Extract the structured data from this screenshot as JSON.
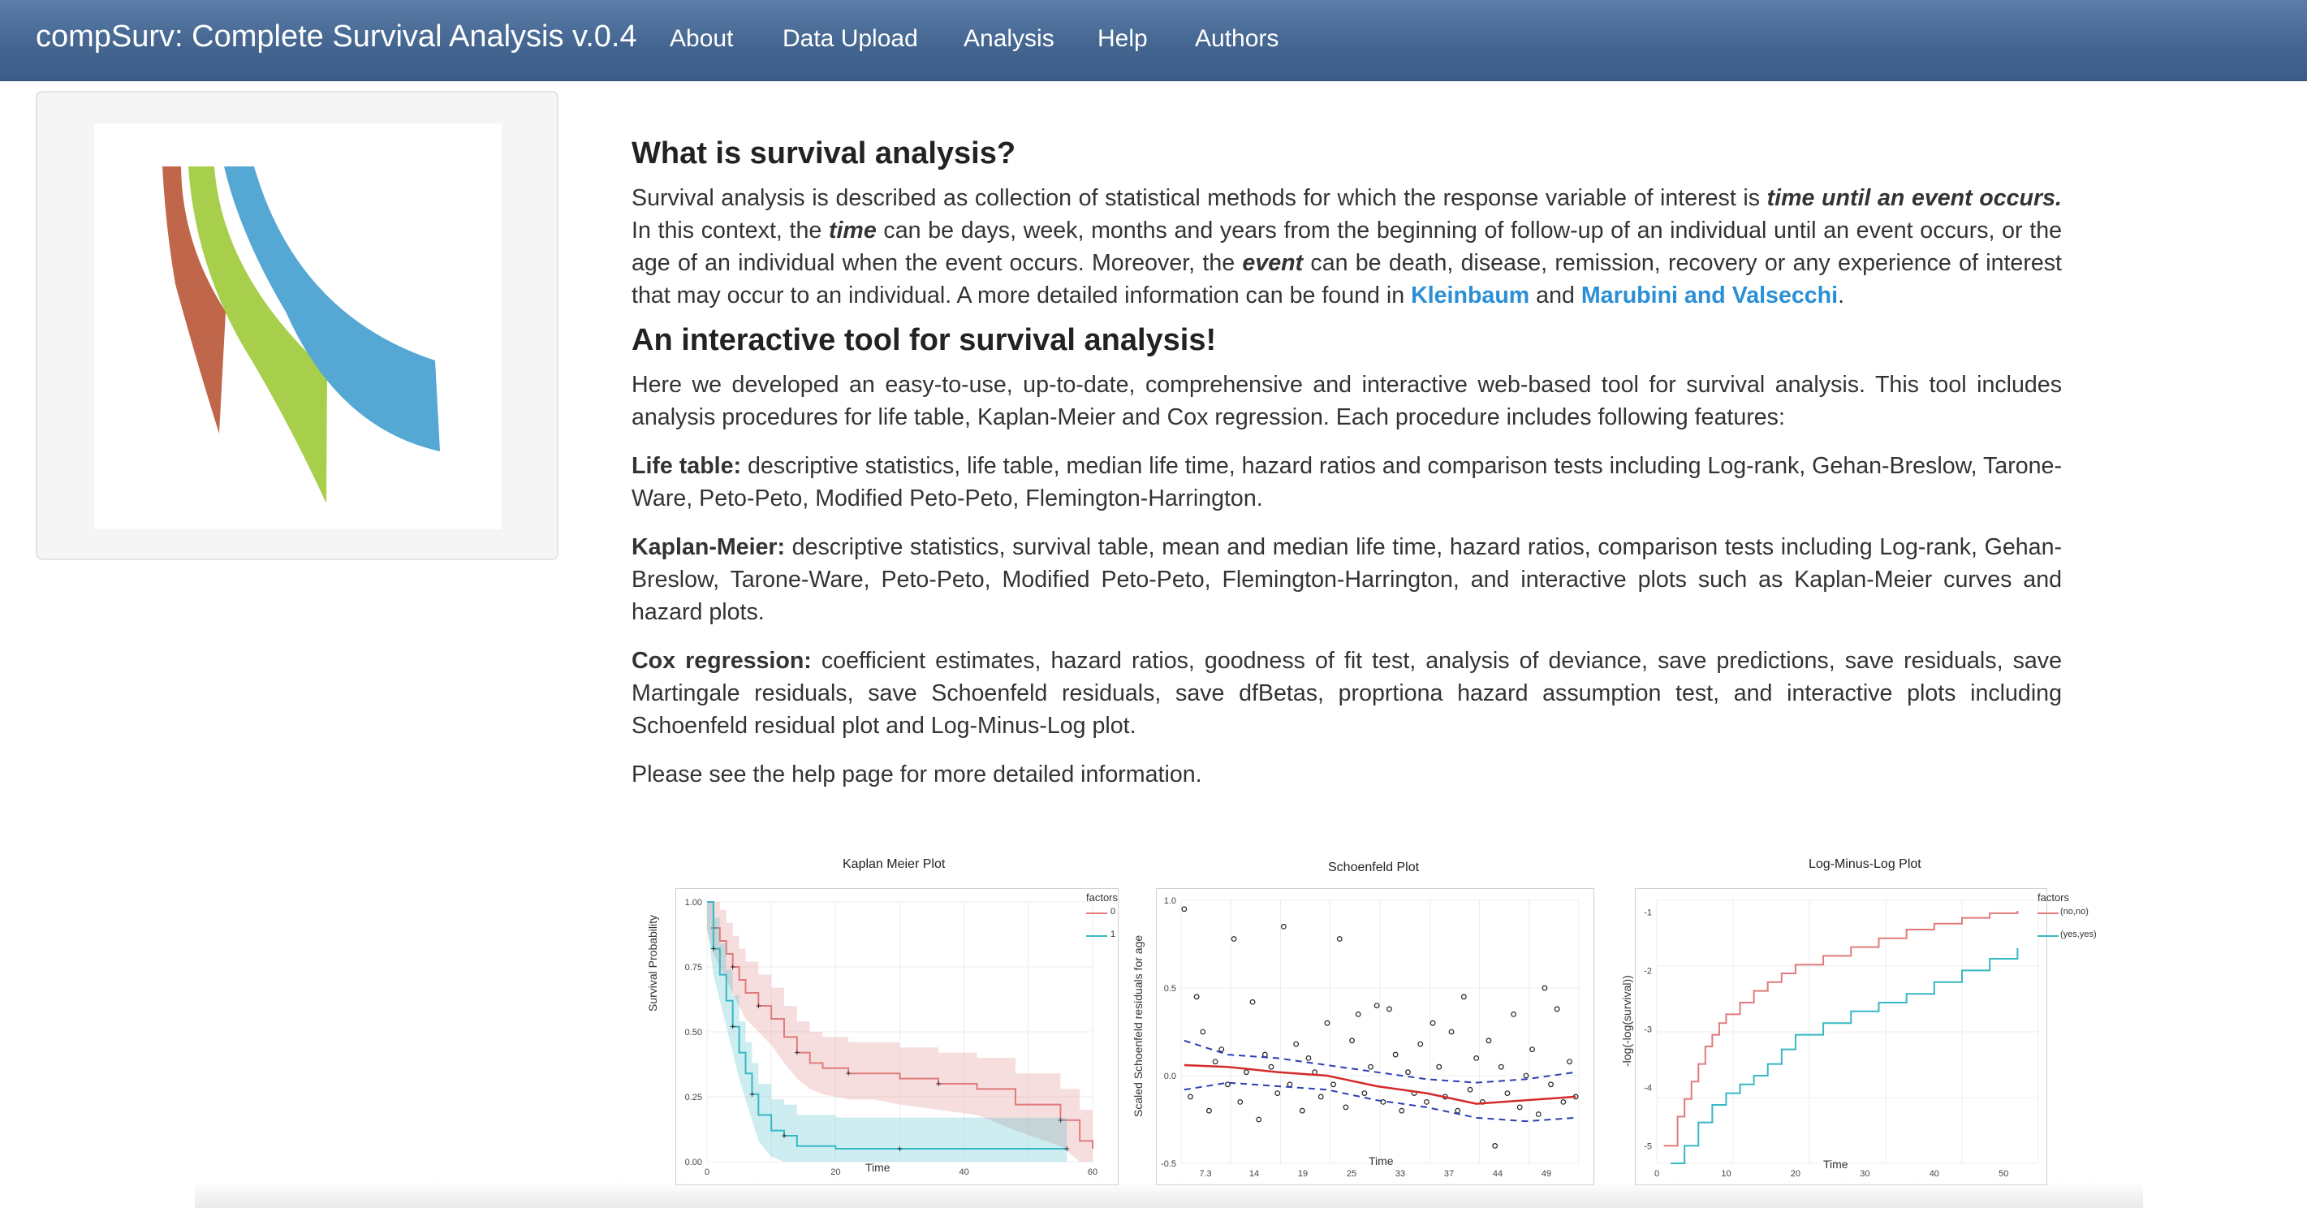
{
  "navbar": {
    "brand": "compSurv: Complete Survival Analysis v.0.4",
    "items": [
      {
        "label": "About",
        "active": true
      },
      {
        "label": "Data Upload"
      },
      {
        "label": "Analysis"
      },
      {
        "label": "Help"
      },
      {
        "label": "Authors"
      }
    ]
  },
  "logo": {
    "icon": "compsurv-logo-icon",
    "colors": [
      "#c0664a",
      "#a8cf4b",
      "#55a8d3"
    ]
  },
  "about": {
    "heading1": "What is survival analysis?",
    "p1": {
      "t1": "Survival analysis is described as collection of statistical methods for which the response variable of interest is ",
      "em1": "time until an event occurs.",
      "t2": " In this context, the ",
      "em2": "time",
      "t3": " can be days, week, months and years from the beginning of follow-up of an individual until an event occurs, or the age of an individual when the event occurs. Moreover, the ",
      "em3": "event",
      "t4": " can be death, disease, remission, recovery or any experience of interest that may occur to an individual. A more detailed information can be found in ",
      "link1": "Kleinbaum",
      "t5": " and ",
      "link2": "Marubini and Valsecchi",
      "t6": "."
    },
    "heading2": "An interactive tool for survival analysis!",
    "p2": "Here we developed an easy-to-use, up-to-date, comprehensive and interactive web-based tool for survival analysis. This tool includes analysis procedures for life table, Kaplan-Meier and Cox regression. Each procedure includes following features:",
    "lifetable": {
      "label": "Life table:",
      "text": " descriptive statistics, life table, median life time, hazard ratios and comparison tests including Log-rank, Gehan-Breslow, Tarone-Ware, Peto-Peto, Modified Peto-Peto, Flemington-Harrington."
    },
    "km": {
      "label": "Kaplan-Meier:",
      "text": " descriptive statistics, survival table, mean and median life time, hazard ratios, comparison tests including Log-rank, Gehan-Breslow, Tarone-Ware, Peto-Peto, Modified Peto-Peto, Flemington-Harrington, and interactive plots such as Kaplan-Meier curves and hazard plots."
    },
    "cox": {
      "label": "Cox regression:",
      "text": " coefficient estimates, hazard ratios, goodness of fit test, analysis of deviance, save predictions, save residuals, save Martingale residuals, save Schoenfeld residuals, save dfBetas, proprtiona hazard assumption test, and interactive plots including Schoenfeld residual plot and Log-Minus-Log plot."
    },
    "p_last": "Please see the help page for more detailed information."
  },
  "chart_data": [
    {
      "type": "line",
      "title": "Kaplan Meier Plot",
      "xlabel": "Time",
      "ylabel": "Survival Probability",
      "xlim": [
        0,
        60
      ],
      "ylim": [
        0,
        1
      ],
      "x_ticks": [
        "0",
        "20",
        "40",
        "60"
      ],
      "y_ticks": [
        "0.00",
        "0.25",
        "0.50",
        "0.75",
        "1.00"
      ],
      "legend": {
        "title": "factors",
        "position": "right"
      },
      "series": [
        {
          "name": "0",
          "color": "#e07b7b",
          "x": [
            0,
            1,
            2,
            3,
            4,
            5,
            6,
            8,
            10,
            12,
            14,
            16,
            18,
            22,
            26,
            30,
            36,
            42,
            48,
            55,
            58,
            60
          ],
          "y": [
            1.0,
            0.9,
            0.85,
            0.8,
            0.75,
            0.7,
            0.65,
            0.6,
            0.55,
            0.48,
            0.42,
            0.38,
            0.36,
            0.34,
            0.34,
            0.32,
            0.3,
            0.28,
            0.22,
            0.16,
            0.08,
            0.05
          ]
        },
        {
          "name": "1",
          "color": "#36b8c4",
          "x": [
            0,
            1,
            2,
            3,
            4,
            5,
            6,
            7,
            8,
            10,
            12,
            14,
            20,
            30,
            40,
            50,
            56
          ],
          "y": [
            1.0,
            0.82,
            0.72,
            0.62,
            0.52,
            0.42,
            0.34,
            0.26,
            0.18,
            0.12,
            0.1,
            0.06,
            0.05,
            0.05,
            0.05,
            0.05,
            0.05
          ]
        }
      ]
    },
    {
      "type": "scatter",
      "title": "Schoenfeld Plot",
      "xlabel": "Time",
      "ylabel": "Scaled Schoenfeld residuals for age",
      "x_ticks": [
        "7.3",
        "14",
        "19",
        "25",
        "33",
        "37",
        "44",
        "49"
      ],
      "y_ticks": [
        "-0.5",
        "0.0",
        "0.5",
        "1.0"
      ],
      "ylim": [
        -0.5,
        1.0
      ],
      "points": [
        [
          1,
          0.95
        ],
        [
          2,
          -0.12
        ],
        [
          3,
          0.45
        ],
        [
          4,
          0.25
        ],
        [
          5,
          -0.2
        ],
        [
          6,
          0.08
        ],
        [
          7,
          0.15
        ],
        [
          8,
          -0.05
        ],
        [
          9,
          0.78
        ],
        [
          10,
          -0.15
        ],
        [
          11,
          0.02
        ],
        [
          12,
          0.42
        ],
        [
          13,
          -0.25
        ],
        [
          14,
          0.12
        ],
        [
          15,
          0.05
        ],
        [
          16,
          -0.1
        ],
        [
          17,
          0.85
        ],
        [
          18,
          -0.05
        ],
        [
          19,
          0.18
        ],
        [
          20,
          -0.2
        ],
        [
          21,
          0.1
        ],
        [
          22,
          0.02
        ],
        [
          23,
          -0.12
        ],
        [
          24,
          0.3
        ],
        [
          25,
          -0.05
        ],
        [
          26,
          0.78
        ],
        [
          27,
          -0.18
        ],
        [
          28,
          0.2
        ],
        [
          29,
          0.35
        ],
        [
          30,
          -0.1
        ],
        [
          31,
          0.05
        ],
        [
          32,
          0.4
        ],
        [
          33,
          -0.15
        ],
        [
          34,
          0.38
        ],
        [
          35,
          0.12
        ],
        [
          36,
          -0.2
        ],
        [
          37,
          0.02
        ],
        [
          38,
          -0.1
        ],
        [
          39,
          0.18
        ],
        [
          40,
          -0.15
        ],
        [
          41,
          0.3
        ],
        [
          42,
          0.05
        ],
        [
          43,
          -0.12
        ],
        [
          44,
          0.25
        ],
        [
          45,
          -0.2
        ],
        [
          46,
          0.45
        ],
        [
          47,
          -0.08
        ],
        [
          48,
          0.1
        ],
        [
          49,
          -0.15
        ],
        [
          50,
          0.2
        ],
        [
          51,
          -0.4
        ],
        [
          52,
          0.05
        ],
        [
          53,
          -0.1
        ],
        [
          54,
          0.35
        ],
        [
          55,
          -0.18
        ],
        [
          56,
          0.0
        ],
        [
          57,
          0.15
        ],
        [
          58,
          -0.22
        ],
        [
          59,
          0.5
        ],
        [
          60,
          -0.05
        ],
        [
          61,
          0.38
        ],
        [
          62,
          -0.15
        ],
        [
          63,
          0.08
        ],
        [
          64,
          -0.12
        ]
      ],
      "fit": [
        [
          1,
          0.06
        ],
        [
          8,
          0.05
        ],
        [
          16,
          0.02
        ],
        [
          24,
          0.0
        ],
        [
          32,
          -0.06
        ],
        [
          40,
          -0.1
        ],
        [
          48,
          -0.16
        ],
        [
          56,
          -0.14
        ],
        [
          64,
          -0.12
        ]
      ],
      "band_upper": [
        [
          1,
          0.2
        ],
        [
          8,
          0.12
        ],
        [
          16,
          0.1
        ],
        [
          24,
          0.06
        ],
        [
          32,
          0.02
        ],
        [
          40,
          -0.02
        ],
        [
          48,
          -0.04
        ],
        [
          56,
          -0.02
        ],
        [
          64,
          0.02
        ]
      ],
      "band_lower": [
        [
          1,
          -0.08
        ],
        [
          8,
          -0.04
        ],
        [
          16,
          -0.06
        ],
        [
          24,
          -0.08
        ],
        [
          32,
          -0.14
        ],
        [
          40,
          -0.18
        ],
        [
          48,
          -0.24
        ],
        [
          56,
          -0.26
        ],
        [
          64,
          -0.24
        ]
      ]
    },
    {
      "type": "line",
      "title": "Log-Minus-Log Plot",
      "xlabel": "Time",
      "ylabel": "-log(-log(survival))",
      "xlim": [
        0,
        55
      ],
      "ylim": [
        -5.3,
        -0.8
      ],
      "x_ticks": [
        "0",
        "10",
        "20",
        "30",
        "40",
        "50"
      ],
      "y_ticks": [
        "-1",
        "-2",
        "-3",
        "-4",
        "-5"
      ],
      "legend": {
        "title": "factors",
        "position": "right"
      },
      "series": [
        {
          "name": "(no,no)",
          "color": "#e07b7b",
          "x": [
            1,
            3,
            4,
            5,
            6,
            7,
            8,
            9,
            10,
            12,
            14,
            16,
            18,
            20,
            24,
            28,
            32,
            36,
            40,
            44,
            48,
            52
          ],
          "y": [
            -5.0,
            -4.5,
            -4.2,
            -3.9,
            -3.6,
            -3.3,
            -3.1,
            -2.9,
            -2.75,
            -2.55,
            -2.35,
            -2.2,
            -2.05,
            -1.9,
            -1.75,
            -1.6,
            -1.45,
            -1.3,
            -1.2,
            -1.1,
            -1.02,
            -0.98
          ]
        },
        {
          "name": "(yes,yes)",
          "color": "#36b8c4",
          "x": [
            2,
            4,
            6,
            8,
            10,
            12,
            14,
            16,
            18,
            20,
            24,
            28,
            32,
            36,
            40,
            44,
            48,
            52
          ],
          "y": [
            -5.3,
            -5.0,
            -4.6,
            -4.3,
            -4.1,
            -3.95,
            -3.8,
            -3.6,
            -3.35,
            -3.1,
            -2.9,
            -2.7,
            -2.55,
            -2.4,
            -2.2,
            -2.0,
            -1.8,
            -1.62
          ]
        }
      ]
    }
  ]
}
